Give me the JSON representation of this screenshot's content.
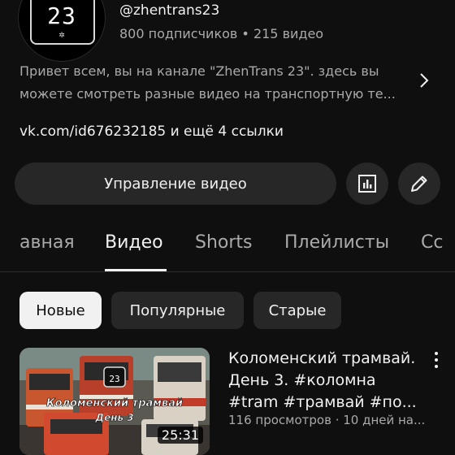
{
  "channel": {
    "avatar_number": "23",
    "avatar_mark": "✲",
    "handle": "@zhentrans23",
    "stats": "800 подписчиков • 215 видео",
    "description": "Привет всем, вы на канале \"ZhenTrans 23\". здесь вы можете смотреть разные видео на транспортную те...",
    "links": "vk.com/id676232185 и ещё 4 ссылки"
  },
  "actions": {
    "manage_label": "Управление видео",
    "analytics_icon": "analytics-icon",
    "edit_icon": "pencil-icon"
  },
  "tabs": [
    {
      "label": "Главная"
    },
    {
      "label": "Видео"
    },
    {
      "label": "Shorts"
    },
    {
      "label": "Плейлисты"
    },
    {
      "label": "Сообщество"
    }
  ],
  "visible_tabs": [
    "авная",
    "Видео",
    "Shorts",
    "Плейлисты",
    "Сс"
  ],
  "chips": [
    "Новые",
    "Популярные",
    "Старые"
  ],
  "video": {
    "title": "Коломенский трамвай. День 3. #коломна #tram #трамвай #по...",
    "meta": "116 просмотров · 10 дней на...",
    "duration": "25:31",
    "thumb_caption": "Коломенский трамвай",
    "thumb_sub": "День 3"
  },
  "colors": {
    "background": "#0f0f0f",
    "surface": "#272727",
    "text": "#f1f1f1",
    "secondary_text": "#aaaaaa"
  }
}
